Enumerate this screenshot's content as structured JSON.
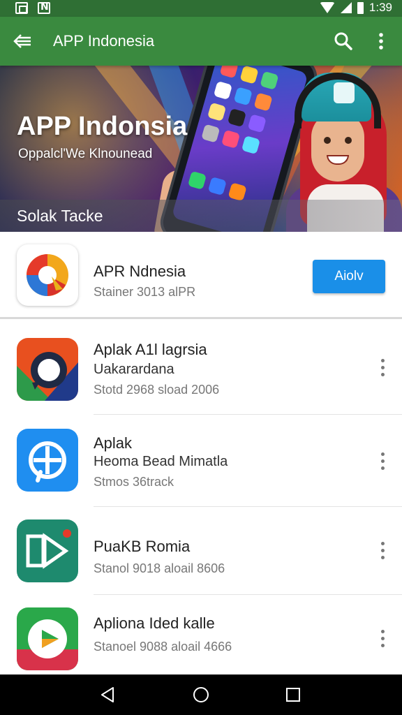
{
  "status_bar": {
    "time": "1:39",
    "left_icons": [
      "gallery-icon",
      "n-notification-icon"
    ],
    "right_icons": [
      "wifi-icon",
      "signal-icon",
      "battery-icon"
    ]
  },
  "app_bar": {
    "title": "APP Indonesia",
    "back_icon": "back-arrow-icon",
    "search_icon": "search-icon",
    "more_icon": "more-vert-icon",
    "color": "#3a8a3f"
  },
  "banner": {
    "title": "APP Indonsia",
    "subtitle": "Oppalcl'We Klnounead",
    "caption": "Solak Tacke"
  },
  "featured": {
    "name": "APR Ndnesia",
    "meta": "Stainer 3013 alPR",
    "button_label": "Aiolv",
    "button_color": "#1a8fe8"
  },
  "apps": [
    {
      "title": "Aplak A1l lagrsia",
      "line2": "Uakarardana",
      "meta": "Stotd 2968 sload 2006",
      "icon": "chat-bubble-icon"
    },
    {
      "title": "Aplak",
      "line2": "Heoma Bead Mimatla",
      "meta": "Stmos 36track",
      "icon": "pinwheel-icon"
    },
    {
      "title": "PuaKB Romia",
      "line2": "",
      "meta": "Stanol 9018 aloail 8606",
      "icon": "play-frame-icon"
    },
    {
      "title": "Apliona Ided kalle",
      "line2": "",
      "meta": "Stanoel 9088 aloail 4666",
      "icon": "play-circle-icon"
    }
  ],
  "nav_bar": {
    "icons": [
      "back-triangle-icon",
      "home-circle-icon",
      "recents-square-icon"
    ]
  }
}
